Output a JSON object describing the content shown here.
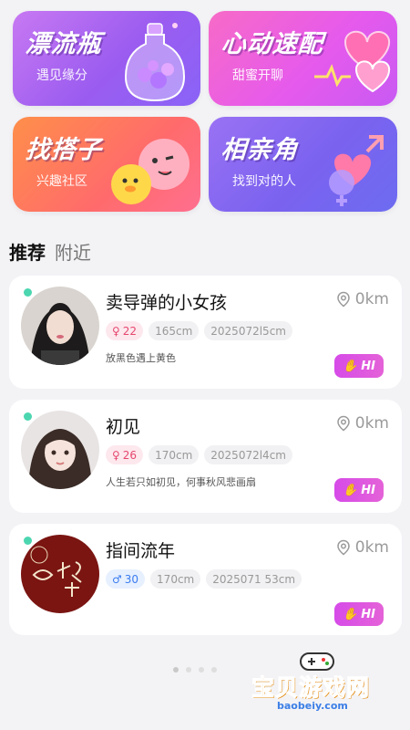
{
  "features": [
    {
      "title": "漂流瓶",
      "subtitle": "遇见缘分"
    },
    {
      "title": "心动速配",
      "subtitle": "甜蜜开聊"
    },
    {
      "title": "找搭子",
      "subtitle": "兴趣社区"
    },
    {
      "title": "相亲角",
      "subtitle": "找到对的人"
    }
  ],
  "tabs": [
    {
      "label": "推荐"
    },
    {
      "label": "附近"
    }
  ],
  "users": [
    {
      "name": "卖导弹的小女孩",
      "distance": "0km",
      "gender": "female",
      "age": "22",
      "height": "165cm",
      "id": "2025072l5cm",
      "bio": "放黑色遇上黄色",
      "hi": "HI",
      "online": true
    },
    {
      "name": "初见",
      "distance": "0km",
      "gender": "female",
      "age": "26",
      "height": "170cm",
      "id": "2025072l4cm",
      "bio": "人生若只如初见，何事秋风悲画扇",
      "hi": "HI",
      "online": true
    },
    {
      "name": "指间流年",
      "distance": "0km",
      "gender": "male",
      "age": "30",
      "height": "170cm",
      "id": "2025071 53cm",
      "bio": "",
      "hi": "HI",
      "online": true
    }
  ],
  "watermark": {
    "text": "宝贝游戏网",
    "url": "baobeiy.com"
  },
  "colors": {
    "accent": "#d64be8",
    "online": "#4bd6b0",
    "female": "#e6476e",
    "male": "#3b7cf0"
  },
  "icons": {
    "distance": "location-pin-icon",
    "gender_female": "female-symbol-icon",
    "gender_male": "male-symbol-icon",
    "hi": "wave-hand-icon"
  }
}
